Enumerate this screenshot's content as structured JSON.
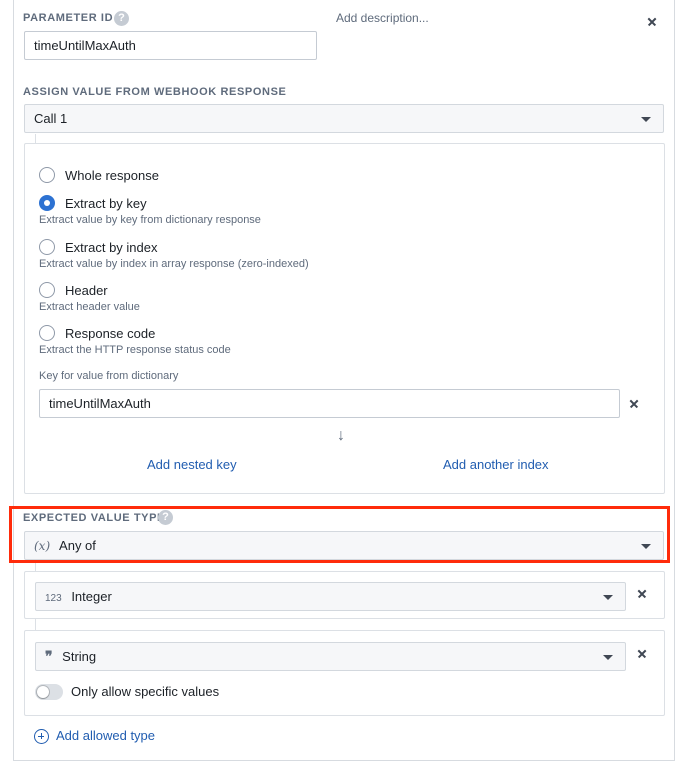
{
  "parameter": {
    "id_label": "PARAMETER ID",
    "help_glyph": "?",
    "id_value": "timeUntilMaxAuth",
    "description_placeholder": "Add description..."
  },
  "assign": {
    "label": "ASSIGN VALUE FROM WEBHOOK RESPONSE",
    "selected": "Call 1"
  },
  "extraction": {
    "options": [
      {
        "label": "Whole response",
        "help": "",
        "checked": false
      },
      {
        "label": "Extract by key",
        "help": "Extract value by key from dictionary response",
        "checked": true
      },
      {
        "label": "Extract by index",
        "help": "Extract value by index in array response (zero-indexed)",
        "checked": false
      },
      {
        "label": "Header",
        "help": "Extract header value",
        "checked": false
      },
      {
        "label": "Response code",
        "help": "Extract the HTTP response status code",
        "checked": false
      }
    ],
    "key_label": "Key for value from dictionary",
    "key_value": "timeUntilMaxAuth",
    "arrow_glyph": "↓",
    "add_nested_key": "Add nested key",
    "add_another_index": "Add another index"
  },
  "expected_type": {
    "label": "EXPECTED VALUE TYPE",
    "help_glyph": "?",
    "icon_text": "(x)",
    "selected": "Any of",
    "highlight_color": "#ff2b0a"
  },
  "allowed_types": [
    {
      "icon_text": "123",
      "icon_name": "integer-icon",
      "value": "Integer"
    },
    {
      "icon_text": "❞",
      "icon_name": "quote-icon",
      "value": "String",
      "toggle_label": "Only allow specific values",
      "toggle_on": false
    }
  ],
  "add_allowed_type": "Add allowed type",
  "colors": {
    "accent": "#2d72d2",
    "link": "#215db0"
  }
}
